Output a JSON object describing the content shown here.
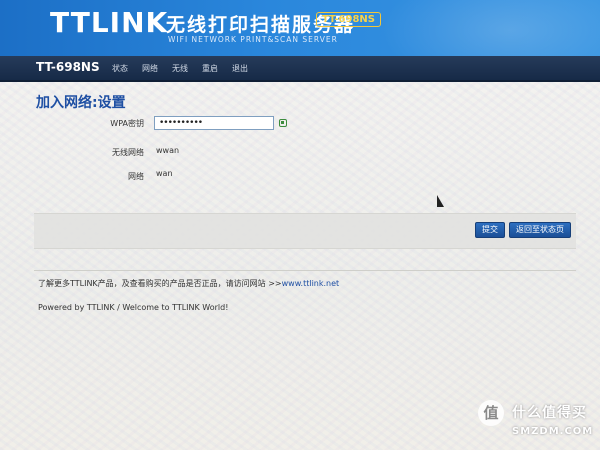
{
  "banner": {
    "logo": "TTLINK",
    "title_cn": "无线打印扫描服务器",
    "title_en": "WIFI NETWORK PRINT&SCAN SERVER",
    "model_badge": "TT-698NS"
  },
  "nav": {
    "device_name": "TT-698NS",
    "items": [
      "状态",
      "网络",
      "无线",
      "重启",
      "退出"
    ]
  },
  "page": {
    "heading": "加入网络:设置",
    "fields": {
      "wpa_label": "WPA密钥",
      "wpa_value": "••••••••••",
      "ssid_label": "无线网络",
      "ssid_value": "wwan",
      "network_label": "网络",
      "network_value": "wan"
    }
  },
  "actions": {
    "submit": "提交",
    "back": "返回至状态页"
  },
  "footer": {
    "info_text": "了解更多TTLINK产品，及查看购买的产品是否正品，请访问网站 >>",
    "info_link": "www.ttlink.net",
    "powered": "Powered by TTLINK / Welcome to TTLINK World!"
  },
  "watermark": {
    "badge": "值",
    "text_cn": "什么值得买",
    "text_en": "SMZDM.COM"
  },
  "colors": {
    "banner_blue": "#2a87dc",
    "nav_dark": "#1c3150",
    "heading_blue": "#1e4fa3",
    "button_blue": "#1b4f97",
    "badge_yellow": "#f7d24a"
  }
}
